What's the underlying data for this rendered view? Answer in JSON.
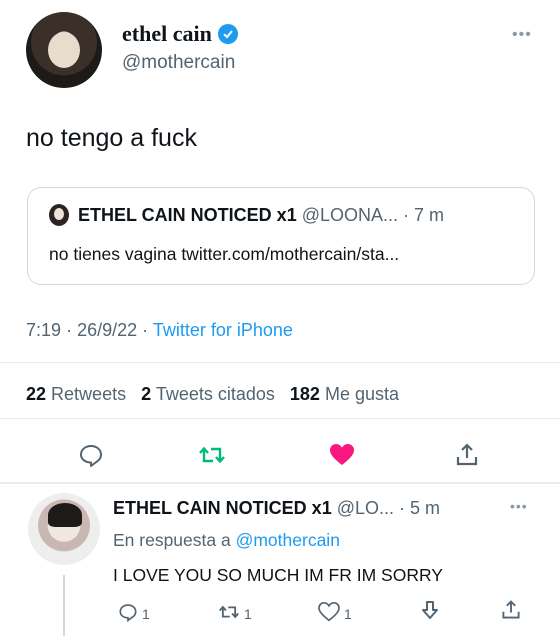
{
  "main_tweet": {
    "author_name": "ethel cain",
    "handle": "@mothercain",
    "text": "no tengo a fuck",
    "quote": {
      "author_name": "ETHEL CAIN NOTICED x1",
      "handle": "@LOONA...",
      "time": "· 7 m",
      "text": "no tienes vagina twitter.com/mothercain/sta..."
    },
    "meta": {
      "time": "7:19",
      "date": "26/9/22",
      "source": "Twitter for iPhone"
    },
    "stats": {
      "retweets_count": "22",
      "retweets_label": "Retweets",
      "quotes_count": "2",
      "quotes_label": "Tweets citados",
      "likes_count": "182",
      "likes_label": "Me gusta"
    }
  },
  "reply": {
    "author_name": "ETHEL CAIN NOTICED x1",
    "handle": "@LO...",
    "time": "· 5 m",
    "replying_to_label": "En respuesta a",
    "replying_to_handle": "@mothercain",
    "text": "I LOVE YOU SO MUCH IM FR IM SORRY",
    "replies_count": "1",
    "retweets_count": "1",
    "likes_count": "1"
  },
  "colors": {
    "accent": "#1d9bf0",
    "like": "#f91880",
    "retweet": "#00ba7c",
    "muted": "#536471"
  },
  "icons": [
    "verified-badge-icon",
    "more-icon",
    "reply-icon",
    "retweet-icon",
    "like-icon",
    "share-icon",
    "download-icon"
  ]
}
